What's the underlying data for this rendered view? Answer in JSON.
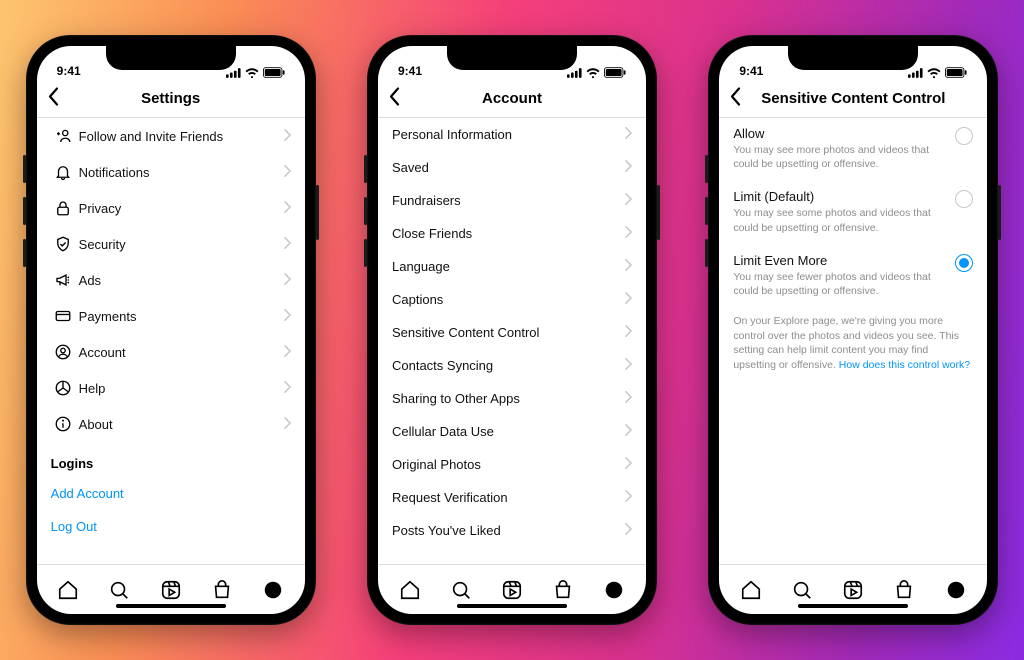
{
  "status": {
    "time": "9:41"
  },
  "phones": [
    {
      "title": "Settings",
      "rows": [
        {
          "icon": "follow",
          "label": "Follow and Invite Friends"
        },
        {
          "icon": "bell",
          "label": "Notifications"
        },
        {
          "icon": "lock",
          "label": "Privacy"
        },
        {
          "icon": "shield",
          "label": "Security"
        },
        {
          "icon": "megaphone",
          "label": "Ads"
        },
        {
          "icon": "card",
          "label": "Payments"
        },
        {
          "icon": "user",
          "label": "Account"
        },
        {
          "icon": "help",
          "label": "Help"
        },
        {
          "icon": "info",
          "label": "About"
        }
      ],
      "logins_header": "Logins",
      "logins": [
        {
          "label": "Add Account"
        },
        {
          "label": "Log Out"
        }
      ]
    },
    {
      "title": "Account",
      "rows": [
        {
          "label": "Personal Information"
        },
        {
          "label": "Saved"
        },
        {
          "label": "Fundraisers"
        },
        {
          "label": "Close Friends"
        },
        {
          "label": "Language"
        },
        {
          "label": "Captions"
        },
        {
          "label": "Sensitive Content Control"
        },
        {
          "label": "Contacts Syncing"
        },
        {
          "label": "Sharing to Other Apps"
        },
        {
          "label": "Cellular Data Use"
        },
        {
          "label": "Original Photos"
        },
        {
          "label": "Request Verification"
        },
        {
          "label": "Posts You've Liked"
        }
      ]
    },
    {
      "title": "Sensitive Content Control",
      "options": [
        {
          "title": "Allow",
          "desc": "You may see more photos and videos that could be upsetting or offensive.",
          "selected": false
        },
        {
          "title": "Limit (Default)",
          "desc": "You may see some photos and videos that could be upsetting or offensive.",
          "selected": false
        },
        {
          "title": "Limit Even More",
          "desc": "You may see fewer photos and videos that could be upsetting or offensive.",
          "selected": true
        }
      ],
      "explain": "On your Explore page, we're giving you more control over the photos and videos you see. This setting can help limit content you may find upsetting or offensive. ",
      "explain_link": "How does this control work?"
    }
  ],
  "tabs": [
    "home",
    "search",
    "reels",
    "shop",
    "profile"
  ]
}
